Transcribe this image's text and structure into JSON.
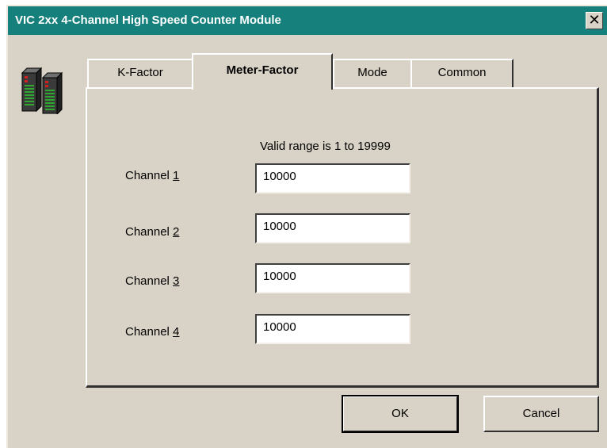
{
  "window": {
    "title": "VIC 2xx 4-Channel High Speed Counter Module",
    "close_glyph": "✕"
  },
  "tabs": [
    {
      "label": "K-Factor",
      "active": false
    },
    {
      "label": "Meter-Factor",
      "active": true
    },
    {
      "label": "Mode",
      "active": false
    },
    {
      "label": "Common",
      "active": false
    }
  ],
  "panel": {
    "hint": "Valid range is 1 to 19999",
    "channels": [
      {
        "prefix": "Channel ",
        "num": "1",
        "value": "10000"
      },
      {
        "prefix": "Channel ",
        "num": "2",
        "value": "10000"
      },
      {
        "prefix": "Channel ",
        "num": "3",
        "value": "10000"
      },
      {
        "prefix": "Channel ",
        "num": "4",
        "value": "10000"
      }
    ]
  },
  "buttons": {
    "ok": "OK",
    "cancel": "Cancel"
  },
  "colors": {
    "titlebar": "#16807c",
    "face": "#d9d2c6"
  },
  "icons": {
    "module": "counter-module-icon",
    "close": "close-icon"
  }
}
